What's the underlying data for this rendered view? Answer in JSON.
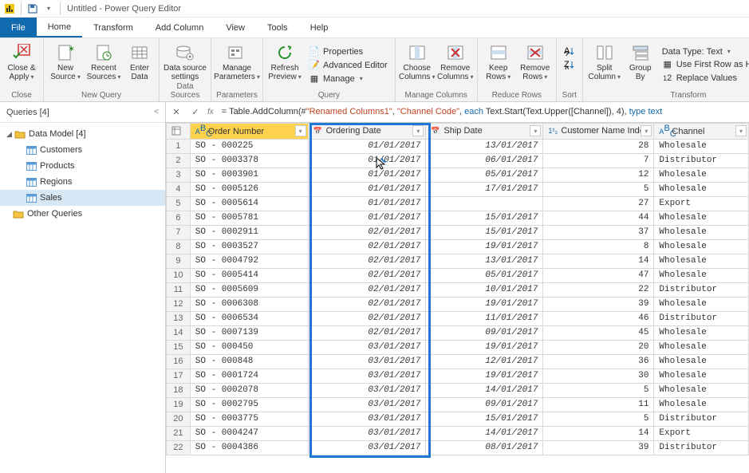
{
  "titlebar": {
    "window_title": "Untitled - Power Query Editor"
  },
  "menubar": {
    "file": "File",
    "home": "Home",
    "transform": "Transform",
    "add_column": "Add Column",
    "view": "View",
    "tools": "Tools",
    "help": "Help"
  },
  "ribbon": {
    "close_apply": "Close &\nApply",
    "close_group": "Close",
    "new_source": "New\nSource",
    "recent_sources": "Recent\nSources",
    "enter_data": "Enter\nData",
    "new_query_group": "New Query",
    "data_source_settings": "Data source\nsettings",
    "data_sources_group": "Data Sources",
    "manage_parameters": "Manage\nParameters",
    "parameters_group": "Parameters",
    "refresh_preview": "Refresh\nPreview",
    "properties": "Properties",
    "advanced_editor": "Advanced Editor",
    "manage": "Manage",
    "query_group": "Query",
    "choose_columns": "Choose\nColumns",
    "remove_columns": "Remove\nColumns",
    "manage_columns_group": "Manage Columns",
    "keep_rows": "Keep\nRows",
    "remove_rows": "Remove\nRows",
    "reduce_rows_group": "Reduce Rows",
    "sort_group": "Sort",
    "split_column": "Split\nColumn",
    "group_by": "Group\nBy",
    "data_type": "Data Type: Text",
    "first_row": "Use First Row as Headers",
    "replace_values": "Replace Values",
    "transform_group": "Transform"
  },
  "queries_pane": {
    "header": "Queries [4]",
    "data_model": "Data Model [4]",
    "items": [
      "Customers",
      "Products",
      "Regions",
      "Sales"
    ],
    "other": "Other Queries",
    "selected": "Sales"
  },
  "formula_bar": {
    "fx": "fx",
    "prefix": "= Table.AddColumn(#",
    "str1": "\"Renamed  Columns1\"",
    "sep1": ", ",
    "str2": "\"Channel Code\"",
    "sep2": ", ",
    "kw_each": "each",
    "mid": " Text.Start(Text.Upper([Channel]), 4), ",
    "kw_type": "type text"
  },
  "columns": {
    "order_number": "Order Number",
    "ordering_date": "Ordering Date",
    "ship_date": "Ship Date",
    "customer_index": "Customer Name Index",
    "channel": "Channel"
  },
  "rows": [
    {
      "n": 1,
      "ord": "SO - 000225",
      "od": "01/01/2017",
      "sd": "13/01/2017",
      "ci": 28,
      "ch": "Wholesale"
    },
    {
      "n": 2,
      "ord": "SO - 0003378",
      "od": "01/01/2017",
      "sd": "06/01/2017",
      "ci": 7,
      "ch": "Distributor"
    },
    {
      "n": 3,
      "ord": "SO - 0003901",
      "od": "01/01/2017",
      "sd": "05/01/2017",
      "ci": 12,
      "ch": "Wholesale"
    },
    {
      "n": 4,
      "ord": "SO - 0005126",
      "od": "01/01/2017",
      "sd": "17/01/2017",
      "ci": 5,
      "ch": "Wholesale"
    },
    {
      "n": 5,
      "ord": "SO - 0005614",
      "od": "01/01/2017",
      "sd": "",
      "ci": 27,
      "ch": "Export"
    },
    {
      "n": 6,
      "ord": "SO - 0005781",
      "od": "01/01/2017",
      "sd": "15/01/2017",
      "ci": 44,
      "ch": "Wholesale"
    },
    {
      "n": 7,
      "ord": "SO - 0002911",
      "od": "02/01/2017",
      "sd": "15/01/2017",
      "ci": 37,
      "ch": "Wholesale"
    },
    {
      "n": 8,
      "ord": "SO - 0003527",
      "od": "02/01/2017",
      "sd": "19/01/2017",
      "ci": 8,
      "ch": "Wholesale"
    },
    {
      "n": 9,
      "ord": "SO - 0004792",
      "od": "02/01/2017",
      "sd": "13/01/2017",
      "ci": 14,
      "ch": "Wholesale"
    },
    {
      "n": 10,
      "ord": "SO - 0005414",
      "od": "02/01/2017",
      "sd": "05/01/2017",
      "ci": 47,
      "ch": "Wholesale"
    },
    {
      "n": 11,
      "ord": "SO - 0005609",
      "od": "02/01/2017",
      "sd": "10/01/2017",
      "ci": 22,
      "ch": "Distributor"
    },
    {
      "n": 12,
      "ord": "SO - 0006308",
      "od": "02/01/2017",
      "sd": "19/01/2017",
      "ci": 39,
      "ch": "Wholesale"
    },
    {
      "n": 13,
      "ord": "SO - 0006534",
      "od": "02/01/2017",
      "sd": "11/01/2017",
      "ci": 46,
      "ch": "Distributor"
    },
    {
      "n": 14,
      "ord": "SO - 0007139",
      "od": "02/01/2017",
      "sd": "09/01/2017",
      "ci": 45,
      "ch": "Wholesale"
    },
    {
      "n": 15,
      "ord": "SO - 000450",
      "od": "03/01/2017",
      "sd": "19/01/2017",
      "ci": 20,
      "ch": "Wholesale"
    },
    {
      "n": 16,
      "ord": "SO - 000848",
      "od": "03/01/2017",
      "sd": "12/01/2017",
      "ci": 36,
      "ch": "Wholesale"
    },
    {
      "n": 17,
      "ord": "SO - 0001724",
      "od": "03/01/2017",
      "sd": "19/01/2017",
      "ci": 30,
      "ch": "Wholesale"
    },
    {
      "n": 18,
      "ord": "SO - 0002078",
      "od": "03/01/2017",
      "sd": "14/01/2017",
      "ci": 5,
      "ch": "Wholesale"
    },
    {
      "n": 19,
      "ord": "SO - 0002795",
      "od": "03/01/2017",
      "sd": "09/01/2017",
      "ci": 11,
      "ch": "Wholesale"
    },
    {
      "n": 20,
      "ord": "SO - 0003775",
      "od": "03/01/2017",
      "sd": "15/01/2017",
      "ci": 5,
      "ch": "Distributor"
    },
    {
      "n": 21,
      "ord": "SO - 0004247",
      "od": "03/01/2017",
      "sd": "14/01/2017",
      "ci": 14,
      "ch": "Export"
    },
    {
      "n": 22,
      "ord": "SO - 0004386",
      "od": "03/01/2017",
      "sd": "08/01/2017",
      "ci": 39,
      "ch": "Distributor"
    }
  ]
}
